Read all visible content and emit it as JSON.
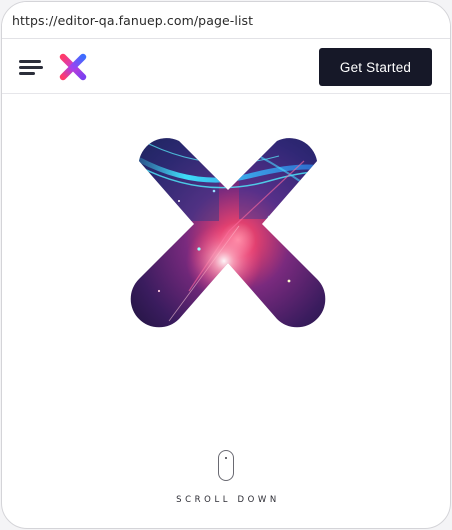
{
  "browser": {
    "url": "https://editor-qa.fanuep.com/page-list"
  },
  "header": {
    "menu_icon": "hamburger-menu-icon",
    "logo_icon": "x-logo-icon",
    "cta_label": "Get Started"
  },
  "hero": {
    "image": "x-shaped-cosmic-artwork"
  },
  "scroll": {
    "icon": "mouse-icon",
    "label": "SCROLL DOWN"
  },
  "colors": {
    "cta_background": "#161828",
    "logo_gradient": [
      "#ff3b6a",
      "#a43ff0",
      "#3d6cff"
    ]
  }
}
